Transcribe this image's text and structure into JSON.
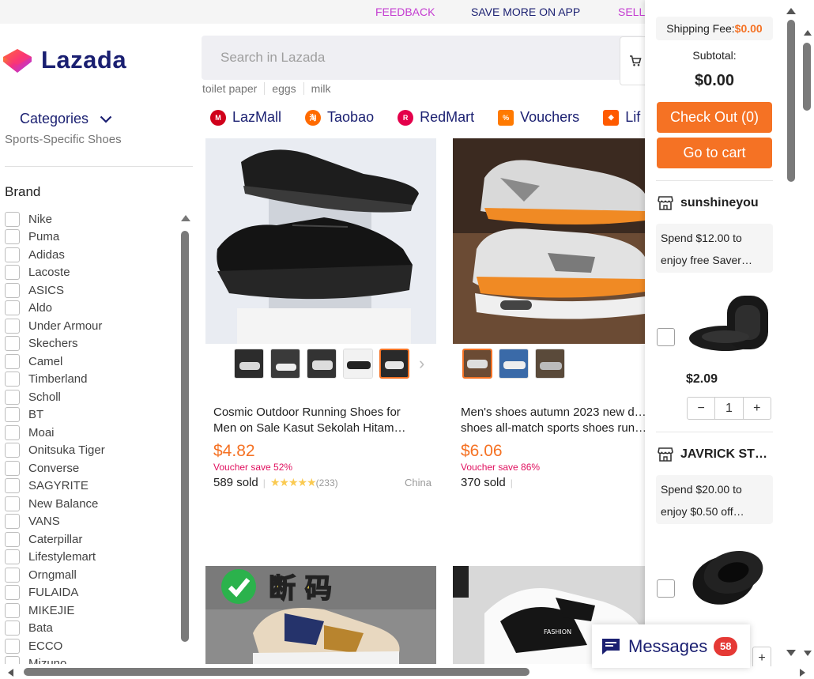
{
  "topbar": {
    "feedback": "FEEDBACK",
    "save_more": "SAVE MORE ON APP",
    "sell": "SELL"
  },
  "logo": {
    "text": "Lazada",
    "icon": "lazada-heart-logo"
  },
  "search": {
    "placeholder": "Search in Lazada",
    "value": ""
  },
  "hot_words": [
    "toilet paper",
    "eggs",
    "milk"
  ],
  "categories_label": "Categories",
  "nav": [
    {
      "label": "LazMall",
      "icon": "lazmall-icon",
      "color": "#d0011b"
    },
    {
      "label": "Taobao",
      "icon": "taobao-icon",
      "color": "#ff6a00"
    },
    {
      "label": "RedMart",
      "icon": "redmart-icon",
      "color": "#e4004b"
    },
    {
      "label": "Vouchers",
      "icon": "voucher-icon",
      "color": "#ff7a00"
    },
    {
      "label": "Lif",
      "icon": "lifestyle-icon",
      "color": "#ff5a00"
    }
  ],
  "filters": {
    "previous_section_cut": "Sports-Specific Shoes",
    "brand_title": "Brand",
    "brands": [
      "Nike",
      "Puma",
      "Adidas",
      "Lacoste",
      "ASICS",
      "Aldo",
      "Under Armour",
      "Skechers",
      "Camel",
      "Timberland",
      "Scholl",
      "BT",
      "Moai",
      "Onitsuka Tiger",
      "Converse",
      "SAGYRITE",
      "New Balance",
      "VANS",
      "Caterpillar",
      "Lifestylemart",
      "Orngmall",
      "FULAIDA",
      "MIKEJIE",
      "Bata",
      "ECCO",
      "Mizuno"
    ]
  },
  "products": [
    {
      "title": "Cosmic Outdoor Running Shoes for Men on Sale Kasut Sekolah Hitam…",
      "price": "$4.82",
      "voucher": "Voucher save 52%",
      "sold": "589 sold",
      "stars": "★★★★★",
      "rating_count": "(233)",
      "location": "China"
    },
    {
      "title": "Men's shoes autumn 2023 new d… shoes all-match sports shoes run…",
      "price": "$6.06",
      "voucher": "Voucher save 86%",
      "sold": "370 sold",
      "stars": "",
      "rating_count": "",
      "location": ""
    },
    {
      "overlay_text": "断 码"
    },
    {
      "brand_mark": "FASHION"
    }
  ],
  "cart": {
    "shipping_label": "Shipping Fee:",
    "shipping_value": "$0.00",
    "subtotal_label": "Subtotal:",
    "subtotal_value": "$0.00",
    "checkout_label": "Check Out (0)",
    "goto_cart_label": "Go to cart",
    "accent": "#f57224",
    "shops": [
      {
        "name": "sunshineyou",
        "promo": "Spend $12.00 to enjoy free Saver…",
        "item_price": "$2.09",
        "qty": "1"
      },
      {
        "name": "JAVRICK ST…",
        "promo": "Spend $20.00 to enjoy $0.50 off…"
      }
    ],
    "stepper_minus": "−",
    "stepper_plus": "+"
  },
  "messages": {
    "label": "Messages",
    "count": "58"
  }
}
